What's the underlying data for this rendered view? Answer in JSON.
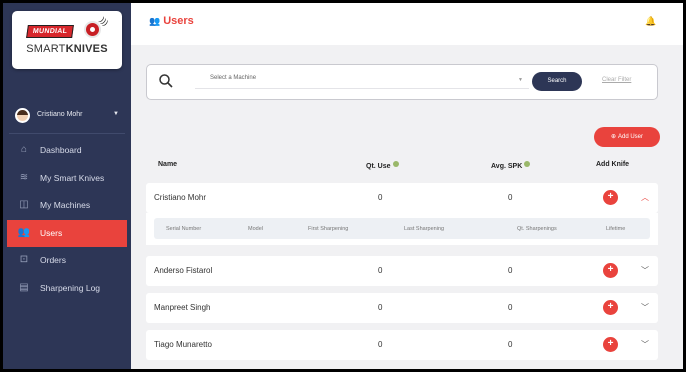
{
  "brand": {
    "badge": "MUNDIAL",
    "name_light": "SMART",
    "name_bold": "KNIVES"
  },
  "user": {
    "name": "Cristiano Mohr"
  },
  "nav": [
    {
      "label": "Dashboard",
      "icon": "home-icon",
      "active": false
    },
    {
      "label": "My Smart Knives",
      "icon": "wifi-icon",
      "active": false
    },
    {
      "label": "My Machines",
      "icon": "machine-icon",
      "active": false
    },
    {
      "label": "Users",
      "icon": "users-icon",
      "active": true
    },
    {
      "label": "Orders",
      "icon": "cart-icon",
      "active": false
    },
    {
      "label": "Sharpening Log",
      "icon": "log-icon",
      "active": false
    }
  ],
  "header": {
    "title": "Users"
  },
  "filter": {
    "select_placeholder": "Select a Machine",
    "search_label": "Search",
    "clear_label": "Clear Filter"
  },
  "toolbar": {
    "add_user_label": "Add User"
  },
  "table": {
    "headers": {
      "name": "Name",
      "qt_use": "Qt. Use",
      "avg_spk": "Avg. SPK",
      "add_knife": "Add Knife"
    },
    "detail_headers": [
      "Serial Number",
      "Model",
      "First Sharpening",
      "Last Sharpening",
      "Qt. Sharpenings",
      "Lifetime"
    ],
    "rows": [
      {
        "name": "Cristiano Mohr",
        "qt_use": "0",
        "avg_spk": "0",
        "expanded": true
      },
      {
        "name": "Anderso Fistarol",
        "qt_use": "0",
        "avg_spk": "0",
        "expanded": false
      },
      {
        "name": "Manpreet Singh",
        "qt_use": "0",
        "avg_spk": "0",
        "expanded": false
      },
      {
        "name": "Tiago Munaretto",
        "qt_use": "0",
        "avg_spk": "0",
        "expanded": false
      }
    ]
  },
  "colors": {
    "accent": "#e9433d",
    "sidebar": "#2d3656",
    "background": "#f1f1f3"
  }
}
